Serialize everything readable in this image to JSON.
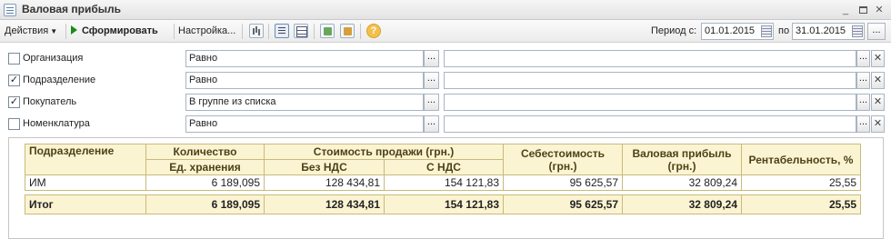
{
  "window": {
    "title": "Валовая прибыль"
  },
  "toolbar": {
    "actions": "Действия",
    "run": "Сформировать",
    "settings": "Настройка...",
    "period_label": "Период с:",
    "date_from": "01.01.2015",
    "po_label": "по",
    "date_to": "31.01.2015",
    "icons": [
      "report-icon",
      "filter-icon",
      "table-icon",
      "save-settings-icon",
      "load-settings-icon",
      "help-icon"
    ]
  },
  "filters": [
    {
      "label": "Организация",
      "checked": false,
      "condition": "Равно",
      "value": ""
    },
    {
      "label": "Подразделение",
      "checked": true,
      "condition": "Равно",
      "value": ""
    },
    {
      "label": "Покупатель",
      "checked": true,
      "condition": "В группе из списка",
      "value": ""
    },
    {
      "label": "Номенклатура",
      "checked": false,
      "condition": "Равно",
      "value": ""
    }
  ],
  "report": {
    "headers": {
      "division": "Подразделение",
      "quantity": "Количество",
      "unit": "Ед. хранения",
      "sale_cost": "Стоимость продажи (грн.)",
      "no_vat": "Без НДС",
      "with_vat": "С НДС",
      "cost": "Себестоимость (грн.)",
      "gross_profit": "Валовая прибыль (грн.)",
      "profitability": "Рентабельность, %"
    },
    "rows": [
      {
        "division": "ИМ",
        "quantity": "6 189,095",
        "no_vat": "128 434,81",
        "with_vat": "154 121,83",
        "cost": "95 625,57",
        "gross_profit": "32 809,24",
        "profitability": "25,55"
      }
    ],
    "total": {
      "label": "Итог",
      "quantity": "6 189,095",
      "no_vat": "128 434,81",
      "with_vat": "154 121,83",
      "cost": "95 625,57",
      "gross_profit": "32 809,24",
      "profitability": "25,55"
    }
  },
  "colors": {
    "header_bg": "#fbf4d3",
    "header_border": "#c9b97a",
    "run_icon": "#1a8a1a"
  }
}
